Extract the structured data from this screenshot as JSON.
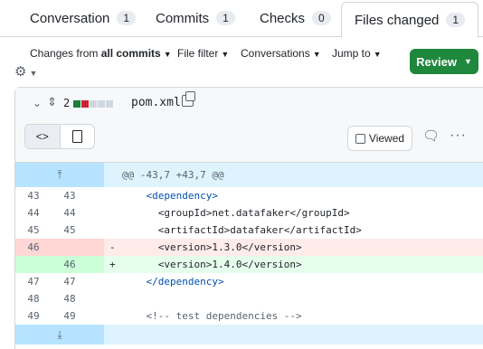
{
  "tabs": [
    {
      "label": "Conversation",
      "count": "1"
    },
    {
      "label": "Commits",
      "count": "1"
    },
    {
      "label": "Checks",
      "count": "0"
    },
    {
      "label": "Files changed",
      "count": "1"
    }
  ],
  "filters": {
    "changes_prefix": "Changes from ",
    "changes_value": "all commits",
    "file_filter": "File filter",
    "conversations": "Conversations",
    "jump_to": "Jump to"
  },
  "review_label": "Review",
  "file": {
    "changes": "2",
    "name": "pom.xml",
    "viewed_label": "Viewed"
  },
  "diff": {
    "hunk_header": "@@ -43,7 +43,7 @@",
    "lines": [
      {
        "old": "43",
        "new": "43",
        "sign": "",
        "code": "    <dependency>"
      },
      {
        "old": "44",
        "new": "44",
        "sign": "",
        "code": "      <groupId>net.datafaker</groupId>"
      },
      {
        "old": "45",
        "new": "45",
        "sign": "",
        "code": "      <artifactId>datafaker</artifactId>"
      },
      {
        "old": "46",
        "new": "",
        "sign": "-",
        "code": "      <version>1.3.0</version>"
      },
      {
        "old": "",
        "new": "46",
        "sign": "+",
        "code": "      <version>1.4.0</version>"
      },
      {
        "old": "47",
        "new": "47",
        "sign": "",
        "code": "    </dependency>"
      },
      {
        "old": "48",
        "new": "48",
        "sign": "",
        "code": ""
      },
      {
        "old": "49",
        "new": "49",
        "sign": "",
        "code": "    <!-- test dependencies -->"
      }
    ]
  },
  "icons": {
    "gear": "gear-icon",
    "code_view": "code-icon",
    "file_view": "file-icon",
    "comment": "comment-icon",
    "kebab": "kebab-horizontal-icon",
    "expand_up": "expand-up-icon",
    "expand_down": "expand-down-icon",
    "copy": "copy-icon",
    "chevron": "chevron-down-icon",
    "move": "move-icon"
  },
  "colors": {
    "review_button": "#1f883d",
    "deletion_bg": "#ffebe9",
    "addition_bg": "#e6ffec",
    "hunk_bg": "#ddf4ff"
  }
}
